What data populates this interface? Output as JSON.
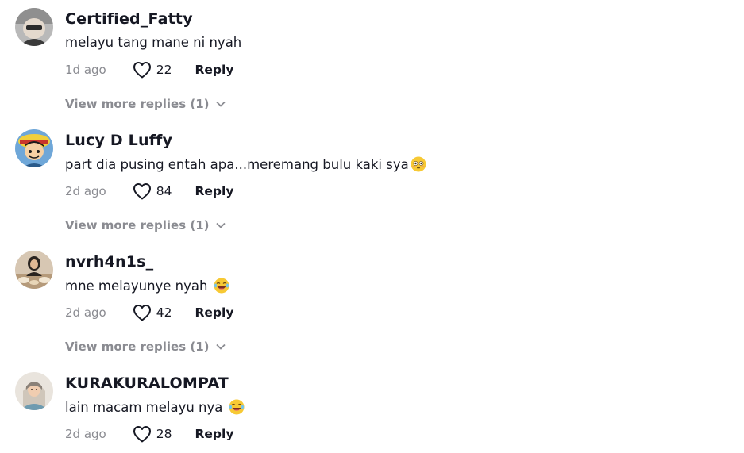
{
  "comments": [
    {
      "username": "Certified_Fatty",
      "text": "melayu tang mane ni nyah",
      "emoji": "",
      "time": "1d ago",
      "likes": "22",
      "reply_label": "Reply",
      "view_more": "View more replies (1)"
    },
    {
      "username": "Lucy D Luffy",
      "text": "part dia pusing entah apa...meremang bulu kaki sya",
      "emoji": "flushed-emoji",
      "time": "2d ago",
      "likes": "84",
      "reply_label": "Reply",
      "view_more": "View more replies (1)"
    },
    {
      "username": "nvrh4n1s_",
      "text": "mne melayunye nyah",
      "emoji": "laughing-emoji",
      "time": "2d ago",
      "likes": "42",
      "reply_label": "Reply",
      "view_more": "View more replies (1)"
    },
    {
      "username": "KURAKURALOMPAT",
      "text": "lain macam melayu nya",
      "emoji": "laughing-emoji",
      "time": "2d ago",
      "likes": "28",
      "reply_label": "Reply",
      "view_more": ""
    }
  ],
  "icons": {
    "like": "heart-outline-icon",
    "expand": "chevron-down-icon"
  },
  "colors": {
    "text": "#161823",
    "muted": "#8a8b91",
    "background": "#ffffff"
  }
}
